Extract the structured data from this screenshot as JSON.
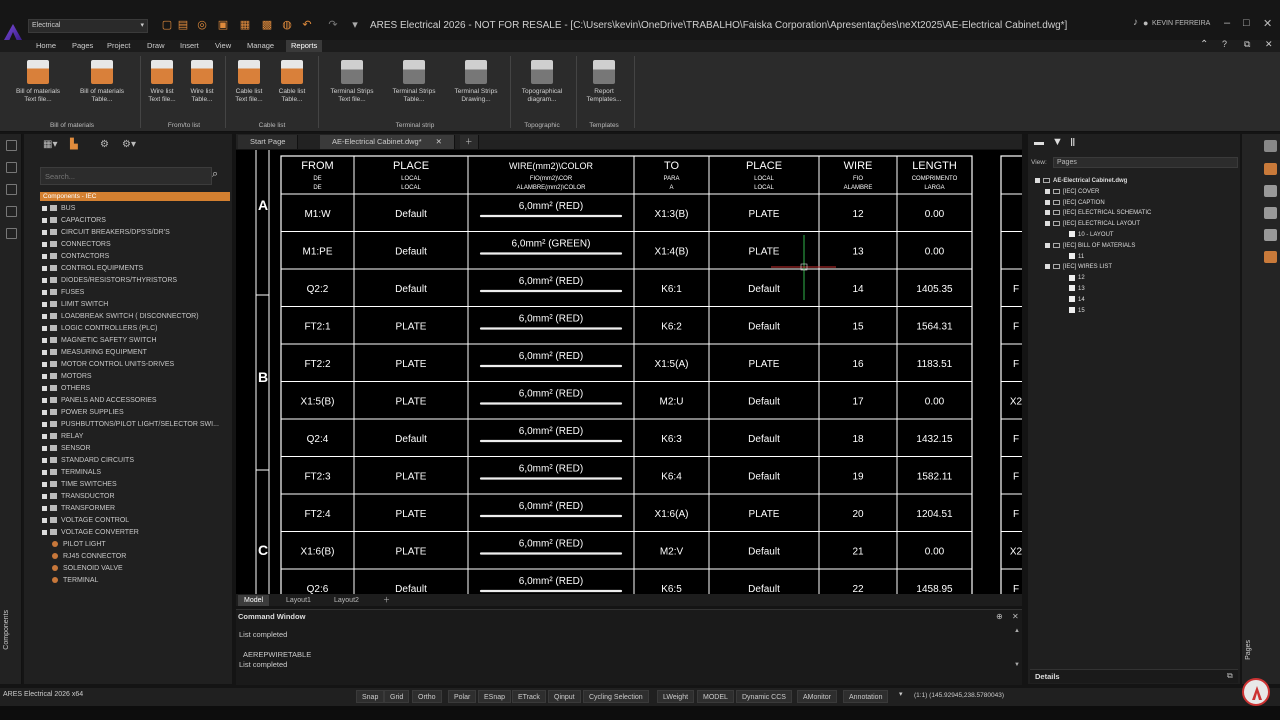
{
  "titlebar": {
    "workspace": "Electrical",
    "title": "ARES Electrical 2026 - NOT FOR RESALE - [C:\\Users\\kevin\\OneDrive\\TRABALHO\\Faiska Corporation\\Apresentações\\neXt2025\\AE-Electrical Cabinet.dwg*]",
    "user": "KEVIN FERREIRA"
  },
  "ribbon_tabs": [
    "Home",
    "Pages",
    "Project",
    "Draw",
    "Insert",
    "View",
    "Manage",
    "Reports"
  ],
  "ribbon": {
    "buttons": [
      {
        "l1": "Bill of materials",
        "l2": "Text file..."
      },
      {
        "l1": "Bill of materials",
        "l2": "Table..."
      },
      {
        "l1": "Wire list",
        "l2": "Text file..."
      },
      {
        "l1": "Wire list",
        "l2": "Table..."
      },
      {
        "l1": "Cable list",
        "l2": "Text file..."
      },
      {
        "l1": "Cable list",
        "l2": "Table..."
      },
      {
        "l1": "Terminal Strips",
        "l2": "Text file..."
      },
      {
        "l1": "Terminal Strips",
        "l2": "Table..."
      },
      {
        "l1": "Terminal Strips",
        "l2": "Drawing..."
      },
      {
        "l1": "Topographical",
        "l2": "diagram..."
      },
      {
        "l1": "Report",
        "l2": "Templates..."
      }
    ],
    "groups": [
      "Bill of materials",
      "From/to list",
      "Cable list",
      "Terminal strip",
      "Topographic",
      "Templates"
    ]
  },
  "components": {
    "search_placeholder": "Search...",
    "header": "Components - IEC",
    "items": [
      "BUS",
      "CAPACITORS",
      "CIRCUIT BREAKERS/DPS'S/DR'S",
      "CONNECTORS",
      "CONTACTORS",
      "CONTROL EQUIPMENTS",
      "DIODES/RESISTORS/THYRISTORS",
      "FUSES",
      "LIMIT SWITCH",
      "LOADBREAK SWITCH ( DISCONNECTOR)",
      "LOGIC CONTROLLERS (PLC)",
      "MAGNETIC SAFETY SWITCH",
      "MEASURING EQUIPMENT",
      "MOTOR CONTROL UNITS-DRIVES",
      "MOTORS",
      "OTHERS",
      "PANELS AND ACCESSORIES",
      "POWER SUPPLIES",
      "PUSHBUTTONS/PILOT LIGHT/SELECTOR SWI...",
      "RELAY",
      "SENSOR",
      "STANDARD CIRCUITS",
      "TERMINALS",
      "TIME SWITCHES",
      "TRANSDUCTOR",
      "TRANSFORMER",
      "VOLTAGE CONTROL",
      "VOLTAGE CONVERTER"
    ],
    "subitems": [
      "PILOT LIGHT",
      "RJ45 CONNECTOR",
      "SOLENOID VALVE",
      "TERMINAL"
    ],
    "vlabel": "Components"
  },
  "doc_tabs": [
    "Start Page",
    "AE-Electrical Cabinet.dwg*"
  ],
  "table": {
    "headers": [
      {
        "main": "FROM",
        "sub1": "DE",
        "sub2": "DE"
      },
      {
        "main": "PLACE",
        "sub1": "LOCAL",
        "sub2": "LOCAL"
      },
      {
        "main": "WIRE(mm2)\\COLOR",
        "sub1": "FIO(mm2)\\COR",
        "sub2": "ALAMBRE(mm2)\\COLOR"
      },
      {
        "main": "TO",
        "sub1": "PARA",
        "sub2": "A"
      },
      {
        "main": "PLACE",
        "sub1": "LOCAL",
        "sub2": "LOCAL"
      },
      {
        "main": "WIRE",
        "sub1": "FIO",
        "sub2": "ALAMBRE"
      },
      {
        "main": "LENGTH",
        "sub1": "COMPRIMENTO",
        "sub2": "LARGA"
      }
    ],
    "rows": [
      [
        "M1:W",
        "Default",
        "6,0mm² (RED)",
        "X1:3(B)",
        "PLATE",
        "12",
        "0.00"
      ],
      [
        "M1:PE",
        "Default",
        "6,0mm² (GREEN)",
        "X1:4(B)",
        "PLATE",
        "13",
        "0.00"
      ],
      [
        "Q2:2",
        "Default",
        "6,0mm² (RED)",
        "K6:1",
        "Default",
        "14",
        "1405.35"
      ],
      [
        "FT2:1",
        "PLATE",
        "6,0mm² (RED)",
        "K6:2",
        "Default",
        "15",
        "1564.31"
      ],
      [
        "FT2:2",
        "PLATE",
        "6,0mm² (RED)",
        "X1:5(A)",
        "PLATE",
        "16",
        "1183.51"
      ],
      [
        "X1:5(B)",
        "PLATE",
        "6,0mm² (RED)",
        "M2:U",
        "Default",
        "17",
        "0.00"
      ],
      [
        "Q2:4",
        "Default",
        "6,0mm² (RED)",
        "K6:3",
        "Default",
        "18",
        "1432.15"
      ],
      [
        "FT2:3",
        "PLATE",
        "6,0mm² (RED)",
        "K6:4",
        "Default",
        "19",
        "1582.11"
      ],
      [
        "FT2:4",
        "PLATE",
        "6,0mm² (RED)",
        "X1:6(A)",
        "PLATE",
        "20",
        "1204.51"
      ],
      [
        "X1:6(B)",
        "PLATE",
        "6,0mm² (RED)",
        "M2:V",
        "Default",
        "21",
        "0.00"
      ],
      [
        "Q2:6",
        "Default",
        "6,0mm² (RED)",
        "K6:5",
        "Default",
        "22",
        "1458.95"
      ]
    ],
    "zones": [
      "A",
      "B",
      "C"
    ],
    "right_partial": [
      "F",
      "F",
      "F",
      "X2",
      "F",
      "F",
      "F",
      "X2",
      "F",
      "F"
    ]
  },
  "layout_tabs": [
    "Model",
    "Layout1",
    "Layout2"
  ],
  "command": {
    "title": "Command Window",
    "lines": [
      "List completed",
      "AEREPWIRETABLE",
      "List completed"
    ]
  },
  "pages_panel": {
    "view_label": "View:",
    "view_value": "Pages",
    "tree": [
      {
        "text": "AE-Electrical Cabinet.dwg",
        "level": 0,
        "kind": "root"
      },
      {
        "text": "[IEC] COVER",
        "level": 1,
        "kind": "folder"
      },
      {
        "text": "[IEC] CAPTION",
        "level": 1,
        "kind": "folder"
      },
      {
        "text": "[IEC] ELECTRICAL SCHEMATIC",
        "level": 1,
        "kind": "folder"
      },
      {
        "text": "[IEC] ELECTRICAL LAYOUT",
        "level": 1,
        "kind": "folder"
      },
      {
        "text": "10 - LAYOUT",
        "level": 2,
        "kind": "page"
      },
      {
        "text": "[IEC] BILL OF MATERIALS",
        "level": 1,
        "kind": "folder"
      },
      {
        "text": "11",
        "level": 2,
        "kind": "page"
      },
      {
        "text": "[IEC] WIRES LIST",
        "level": 1,
        "kind": "folder"
      },
      {
        "text": "12",
        "level": 2,
        "kind": "page"
      },
      {
        "text": "13",
        "level": 2,
        "kind": "page"
      },
      {
        "text": "14",
        "level": 2,
        "kind": "page"
      },
      {
        "text": "15",
        "level": 2,
        "kind": "page"
      }
    ],
    "details": "Details",
    "vlabel": "Pages"
  },
  "status": {
    "version": "ARES Electrical 2026 x64",
    "buttons": [
      "Snap",
      "Grid",
      "Ortho",
      "Polar",
      "ESnap",
      "ETrack",
      "Qinput",
      "Cycling Selection",
      "LWeight",
      "MODEL",
      "Dynamic CCS",
      "AMonitor",
      "Annotation"
    ],
    "coords": "(1:1)  (145.92945,238.5780043)"
  },
  "colors": {
    "accent": "#d48030",
    "ribbon_bg": "#2b2b2b",
    "panel_bg": "#202020",
    "drawing_bg": "#000000"
  }
}
